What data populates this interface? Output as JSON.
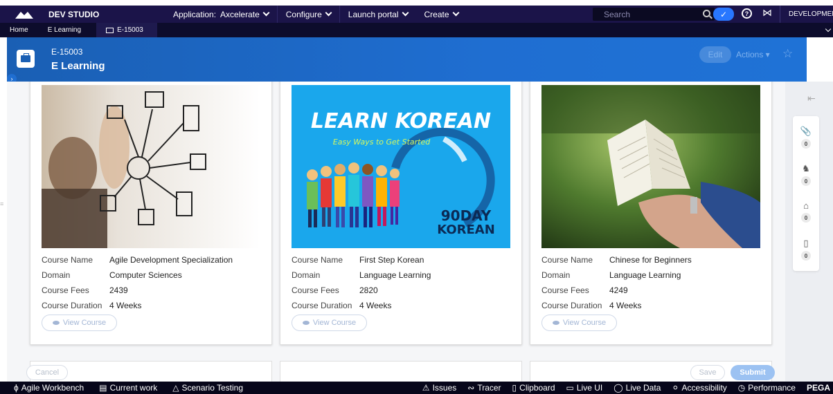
{
  "topbar": {
    "studio": "DEV STUDIO",
    "menu": [
      {
        "label": "Application:",
        "value": "Axcelerate"
      },
      {
        "label": "Configure"
      },
      {
        "label": "Launch portal"
      },
      {
        "label": "Create"
      }
    ],
    "search_placeholder": "Search",
    "help_glyph": "?",
    "env_label": "DEVELOPMENT"
  },
  "tabs": [
    {
      "label": "Home"
    },
    {
      "label": "E Learning"
    },
    {
      "label": "E-15003",
      "active": true
    }
  ],
  "header": {
    "case_id": "E-15003",
    "case_name": "E Learning",
    "edit_label": "Edit",
    "actions_label": "Actions ▾",
    "star": "☆"
  },
  "labels": {
    "course_name": "Course Name",
    "domain": "Domain",
    "course_fees": "Course Fees",
    "course_duration": "Course Duration",
    "view_course": "View Course"
  },
  "cards": [
    {
      "name": "Agile Development Specialization",
      "domain": "Computer Sciences",
      "fees": "2439",
      "duration": "4 Weeks"
    },
    {
      "name": "First Step Korean",
      "domain": "Language Learning",
      "fees": "2820",
      "duration": "4 Weeks",
      "image_title": "LEARN KOREAN",
      "image_subtitle": "Easy Ways to Get Started",
      "image_badge_1": "90DAY",
      "image_badge_2": "KOREAN"
    },
    {
      "name": "Chinese for Beginners",
      "domain": "Language Learning",
      "fees": "4249",
      "duration": "4 Weeks"
    }
  ],
  "utilities": [
    {
      "icon": "paperclip-icon",
      "count": "0"
    },
    {
      "icon": "people-icon",
      "count": "0"
    },
    {
      "icon": "tag-icon",
      "count": "0"
    },
    {
      "icon": "clipboard-icon",
      "count": "0"
    }
  ],
  "buttons": {
    "cancel": "Cancel",
    "save": "Save",
    "submit": "Submit"
  },
  "bottombar": {
    "left": [
      "Agile Workbench",
      "Current work",
      "Scenario Testing"
    ],
    "right": [
      "Issues",
      "Tracer",
      "Clipboard",
      "Live UI",
      "Live Data",
      "Accessibility",
      "Performance"
    ],
    "brand": "PEGA"
  },
  "colors": {
    "topbar": "#1b1449",
    "header": "#1f6ed1",
    "submit": "#9cc2f2"
  }
}
